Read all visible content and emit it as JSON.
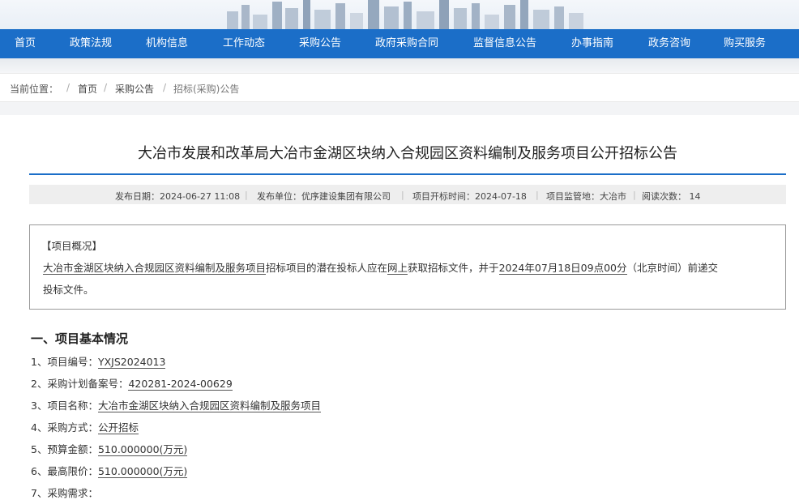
{
  "nav": {
    "items": [
      "首页",
      "政策法规",
      "机构信息",
      "工作动态",
      "采购公告",
      "政府采购合同",
      "监督信息公告",
      "办事指南",
      "政务咨询",
      "购买服务"
    ]
  },
  "breadcrumb": {
    "label": "当前位置：",
    "sep": "/",
    "home": "首页",
    "category": "采购公告",
    "current": "招标(采购)公告"
  },
  "article": {
    "title": "大冶市发展和改革局大冶市金湖区块纳入合规园区资料编制及服务项目公开招标公告",
    "meta": {
      "publish_date": "发布日期：2024-06-27 11:08",
      "publisher": "发布单位：优序建设集团有限公司",
      "open_date": "项目开标时间：2024-07-18",
      "supervision": "项目监管地：大冶市",
      "views": "阅读次数： 14"
    }
  },
  "overview": {
    "heading": "【项目概况】",
    "p1_project": "大冶市金湖区块纳入合规园区资料编制及服务项目",
    "p1_mid": "招标项目的潜在投标人应在",
    "p1_place": "网上",
    "p1_mid2": "获取招标文件，并于",
    "p1_time": "2024年07月18日09点00分",
    "p1_end": "（北京时间）前递交",
    "p2": "投标文件。"
  },
  "section1": {
    "heading": "一、项目基本情况",
    "items": [
      {
        "label": "1、项目编号：",
        "value": "YXJS2024013"
      },
      {
        "label": "2、采购计划备案号：",
        "value": "420281-2024-00629"
      },
      {
        "label": "3、项目名称：",
        "value": "大冶市金湖区块纳入合规园区资料编制及服务项目"
      },
      {
        "label": "4、采购方式：",
        "value": "公开招标"
      },
      {
        "label": "5、预算金额：",
        "value": "510.000000(万元)"
      },
      {
        "label": "6、最高限价：",
        "value": "510.000000(万元)"
      },
      {
        "label": "7、采购需求：",
        "value": ""
      }
    ]
  },
  "colors": {
    "nav_bg": "#1b6ec8",
    "title_rule": "#1b6ec8",
    "meta_bg": "#eeeeee"
  }
}
